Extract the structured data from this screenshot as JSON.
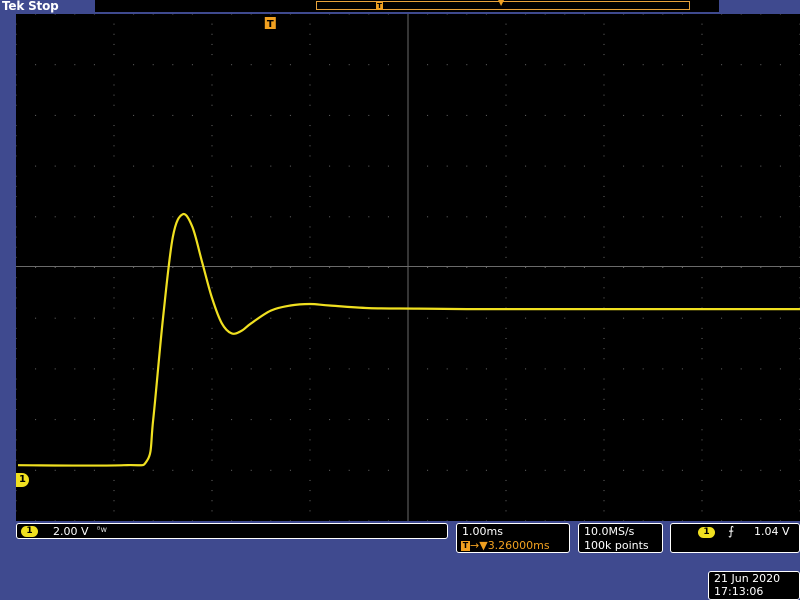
{
  "header": {
    "brand": "Tek",
    "acquisition_state": "Stop"
  },
  "screen": {
    "trace_color": "#f0e020",
    "trigger_color": "#f0a020",
    "channel_label": "1",
    "trigger_marker": "T"
  },
  "readouts": {
    "channel": {
      "badge": "1",
      "scale": "2.00 V",
      "bandwidth_icon": "bandwidth-limit-icon"
    },
    "timebase": {
      "scale": "1.00ms",
      "trigger_position": "3.26000ms"
    },
    "acquisition": {
      "sample_rate": "10.0MS/s",
      "record_length": "100k points"
    },
    "trigger": {
      "source": "1",
      "slope_icon": "rising-edge-icon",
      "level": "1.04 V"
    },
    "datetime": {
      "date": "21 Jun  2020",
      "time": "17:13:06"
    }
  },
  "chart_data": {
    "type": "line",
    "series": [
      {
        "x": [
          -2.58,
          -1.5,
          -1.26,
          -1.2,
          -1.1,
          -1.0,
          -0.9,
          -0.8,
          -0.7,
          -0.6,
          -0.5,
          -0.4,
          -0.3,
          -0.2,
          0.0,
          0.2,
          0.4,
          0.6,
          1.0,
          1.5,
          2.0,
          3.0,
          4.0,
          5.0,
          5.4
        ],
        "y": [
          -3.9,
          -3.9,
          -3.8,
          -3.0,
          -1.0,
          0.6,
          1.05,
          0.8,
          0.1,
          -0.6,
          -1.1,
          -1.3,
          -1.25,
          -1.1,
          -0.85,
          -0.75,
          -0.72,
          -0.75,
          -0.8,
          -0.81,
          -0.82,
          -0.82,
          -0.82,
          -0.82,
          -0.82
        ]
      }
    ],
    "xlim": [
      -2.6,
      5.4
    ],
    "ylim": [
      -5,
      5
    ],
    "grid": true
  }
}
